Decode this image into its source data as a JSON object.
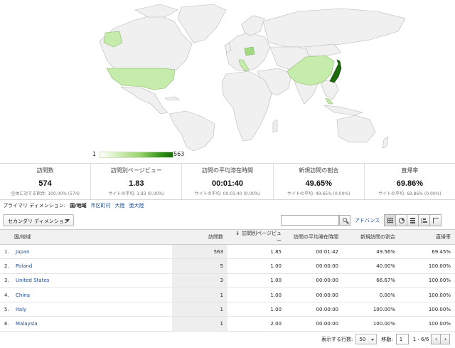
{
  "legend": {
    "min": "1",
    "max": "563"
  },
  "colors": {
    "link": "#1a4c94",
    "map_land": "#f0f0f0",
    "map_border": "#b8b8b8",
    "japan": "#1d6b0d",
    "light_green": "#c6ecac",
    "mid_green": "#a2da82"
  },
  "summary": [
    {
      "label": "訪問数",
      "value": "574",
      "sub": "全体に対する割合: 100.00% (574)"
    },
    {
      "label": "訪問別ページビュー",
      "value": "1.83",
      "sub": "サイトの平均: 1.83 (0.00%)"
    },
    {
      "label": "訪問の平均滞在時間",
      "value": "00:01:40",
      "sub": "サイトの平均: 00:01:40 (0.00%)"
    },
    {
      "label": "新規訪問の割合",
      "value": "49.65%",
      "sub": "サイトの平均: 49.65% (0.00%)"
    },
    {
      "label": "直帰率",
      "value": "69.86%",
      "sub": "サイトの平均: 69.86% (0.00%)"
    }
  ],
  "dimension_bar": {
    "label": "プライマリ ディメンション:",
    "current": "国/地域",
    "options": [
      "市区町村",
      "大陸",
      "亜大陸"
    ]
  },
  "secondary_dimension": "セカンダリ ディメンション",
  "search": {
    "placeholder": "",
    "icon": "search-icon"
  },
  "advanced_label": "アドバンス",
  "table": {
    "headers": {
      "dimension": "国/地域",
      "visits": "訪問数",
      "pages_per_visit": "訪問別ページビュー",
      "avg_duration": "訪問の平均滞在時間",
      "new_visits": "新規訪問の割合",
      "bounce": "直帰率"
    },
    "sort_arrow": "↓",
    "rows": [
      {
        "num": "1.",
        "country": "Japan",
        "visits": "563",
        "ppv": "1.85",
        "duration": "00:01:42",
        "new": "49.56%",
        "bounce": "69.45%"
      },
      {
        "num": "2.",
        "country": "Poland",
        "visits": "5",
        "ppv": "1.00",
        "duration": "00:00:00",
        "new": "40.00%",
        "bounce": "100.00%"
      },
      {
        "num": "3.",
        "country": "United States",
        "visits": "3",
        "ppv": "1.00",
        "duration": "00:00:00",
        "new": "66.67%",
        "bounce": "100.00%"
      },
      {
        "num": "4.",
        "country": "China",
        "visits": "1",
        "ppv": "1.00",
        "duration": "00:00:00",
        "new": "0.00%",
        "bounce": "100.00%"
      },
      {
        "num": "5.",
        "country": "Italy",
        "visits": "1",
        "ppv": "1.00",
        "duration": "00:00:00",
        "new": "100.00%",
        "bounce": "100.00%"
      },
      {
        "num": "6.",
        "country": "Malaysia",
        "visits": "1",
        "ppv": "2.00",
        "duration": "00:00:00",
        "new": "100.00%",
        "bounce": "100.00%"
      }
    ]
  },
  "pager": {
    "rows_label": "表示する行数:",
    "rows_value": "50",
    "goto_label": "移動:",
    "goto_value": "1",
    "range": "1 - 6/6",
    "prev": "‹",
    "next": "›"
  }
}
